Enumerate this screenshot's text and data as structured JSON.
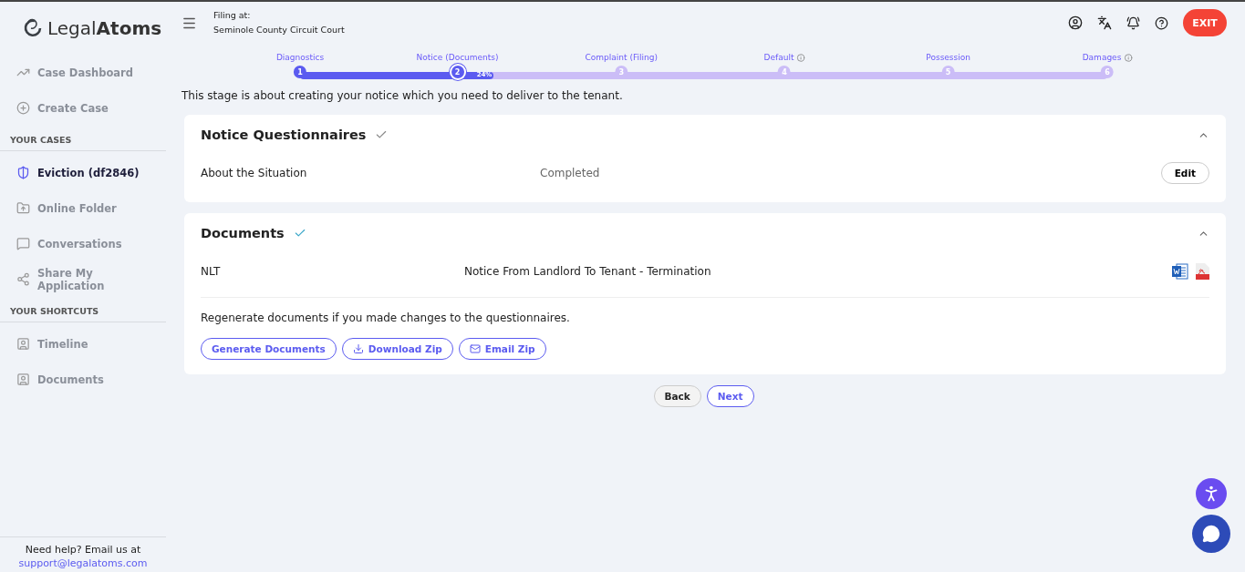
{
  "logo": {
    "text_light": "Legal",
    "text_bold": "Atoms"
  },
  "sidebar": {
    "items": [
      {
        "label": "Case Dashboard",
        "selected": false
      },
      {
        "label": "Create Case",
        "selected": false
      }
    ],
    "sections": [
      {
        "title": "YOUR CASES",
        "items": [
          {
            "label": "Eviction (df2846)",
            "selected": true
          },
          {
            "label": "Online Folder",
            "selected": false
          },
          {
            "label": "Conversations",
            "selected": false
          },
          {
            "label": "Share My Application",
            "selected": false
          }
        ]
      },
      {
        "title": "YOUR SHORTCUTS",
        "items": [
          {
            "label": "Timeline",
            "selected": false
          },
          {
            "label": "Documents",
            "selected": false
          }
        ]
      }
    ],
    "help": {
      "text": "Need help? Email us at",
      "email": "support@legalatoms.com"
    }
  },
  "header": {
    "filing_label": "Filing at:",
    "court": "Seminole County Circuit Court",
    "exit": "EXIT"
  },
  "stepper": {
    "level": 0.24,
    "percent": "24%",
    "steps": [
      {
        "label": "Diagnostics",
        "number": "1",
        "complete": true,
        "selected": false,
        "info": false
      },
      {
        "label": "Notice (Documents)",
        "number": "2",
        "complete": true,
        "selected": true,
        "info": false
      },
      {
        "label": "Complaint (Filing)",
        "number": "3",
        "complete": false,
        "selected": false,
        "info": false
      },
      {
        "label": "Default",
        "number": "4",
        "complete": false,
        "selected": false,
        "info": true
      },
      {
        "label": "Possession",
        "number": "5",
        "complete": false,
        "selected": false,
        "info": false
      },
      {
        "label": "Damages",
        "number": "6",
        "complete": false,
        "selected": false,
        "info": true
      }
    ]
  },
  "intro": "This stage is about creating your notice which you need to deliver to the tenant.",
  "questionnaires": {
    "title": "Notice Questionnaires",
    "complete": true,
    "rows": [
      {
        "name": "About the Situation",
        "status": "Completed",
        "action": "Edit"
      }
    ]
  },
  "documents": {
    "title": "Documents",
    "complete": true,
    "rows": [
      {
        "code": "NLT",
        "name": "Notice From Landlord To Tenant - Termination"
      }
    ],
    "note": "Regenerate documents if you made changes to the questionnaires.",
    "buttons": [
      "Generate Documents",
      "Download Zip",
      "Email Zip"
    ]
  },
  "nav": {
    "back": "Back",
    "next": "Next"
  }
}
